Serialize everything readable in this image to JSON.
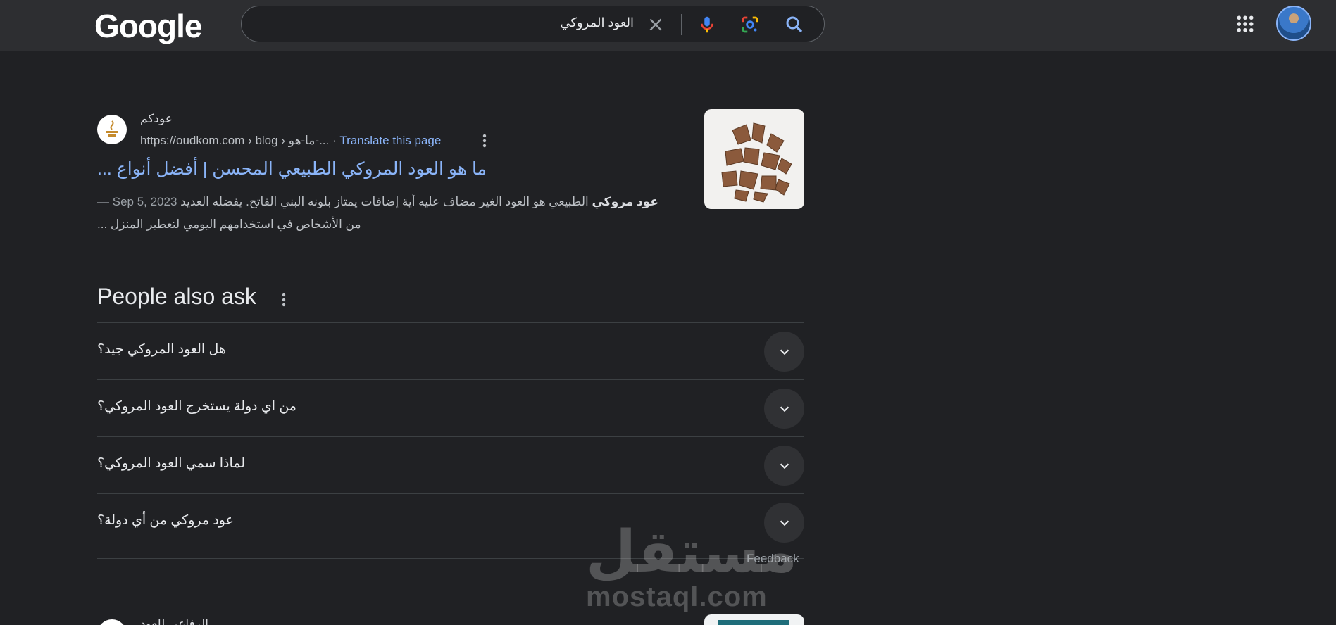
{
  "header": {
    "logo": "Google",
    "search": {
      "query": "العود المروكي"
    }
  },
  "result": {
    "site_name": "عودكم",
    "site_icon_text": "عودكم",
    "url": "https://oudkom.com › blog › ما-هو-...",
    "translate_label": "Translate this page",
    "title": "ما هو العود المروكي الطبيعي المحسن | أفضل أنواع ...",
    "date": "Sep 5, 2023 —",
    "snippet_bold": "عود مروكي",
    "snippet_rest": " الطبيعي هو العود الغير مضاف عليه أية إضافات يمتاز بلونه البني الفاتح. يفضله العديد",
    "snippet_line2": "من الأشخاص في استخدامهم اليومي لتعطير المنزل ..."
  },
  "paa": {
    "title": "People also ask",
    "questions": [
      "هل العود المروكي جيد؟",
      "من اي دولة يستخرج العود المروكي؟",
      "لماذا سمي العود المروكي؟",
      "عود مروكي من أي دولة؟"
    ],
    "feedback": "Feedback"
  },
  "watermark": {
    "arabic": "مستقل",
    "latin": "mostaql.com"
  },
  "next_result": {
    "site_name": "الرفاعي للعود"
  },
  "colors": {
    "background": "#202124",
    "header": "#2d2e31",
    "link": "#8ab4f8",
    "text": "#e8eaed",
    "muted": "#bdc1c6"
  },
  "icons": [
    "clear-icon",
    "mic-icon",
    "lens-icon",
    "search-icon",
    "apps-icon",
    "more-vert-icon",
    "chevron-down-icon"
  ]
}
